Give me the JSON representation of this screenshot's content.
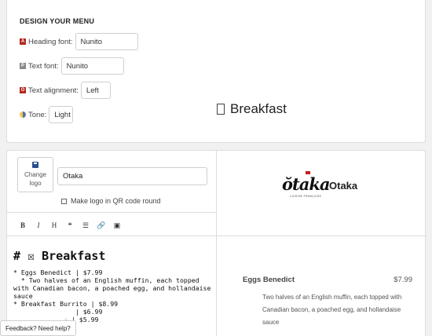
{
  "design": {
    "title": "DESIGN YOUR MENU",
    "options": [
      {
        "icon": "heading-font-icon",
        "icon_glyph": "A",
        "label": "Heading font:",
        "value": "Nunito"
      },
      {
        "icon": "text-font-icon",
        "icon_glyph": "P",
        "label": "Text font:",
        "value": "Nunito"
      },
      {
        "icon": "text-alignment-icon",
        "icon_glyph": "O",
        "label": "Text alignment:",
        "value": "Left"
      },
      {
        "icon": "tone-icon",
        "icon_glyph": "",
        "label": "Tone:",
        "value": "Light"
      }
    ]
  },
  "editor": {
    "change_logo_label_1": "Change",
    "change_logo_label_2": "logo",
    "restaurant_name": "Otaka",
    "round_logo_label": "Make logo in QR code round",
    "toolbar": [
      "B",
      "I",
      "H",
      "❝",
      "☰",
      "🔗",
      "▣"
    ],
    "markdown_lines": [
      "# ☒ Breakfast",
      "",
      "* Eggs Benedict | $7.99",
      "  * Two halves of an English muffin, each topped",
      "with Canadian bacon, a poached egg, and hollandaise",
      "sauce",
      "",
      "* Breakfast Burrito | $8.99",
      "                | $6.99",
      "             ☕ | $5.99"
    ]
  },
  "preview": {
    "logo_text": "ŏtaka",
    "logo_tagline": "CUISINE FRANÇAISE",
    "name": "Otaka",
    "section_title": "Breakfast",
    "item_name": "Eggs Benedict",
    "item_price": "$7.99",
    "item_desc_lines": [
      "Two halves of an English muffin, each topped with",
      "Canadian bacon, a poached egg, and hollandaise",
      "sauce"
    ]
  },
  "feedback_label": "Feedback? Need help?",
  "colors": {
    "accent_red": "#b3261e",
    "save_icon_blue": "#2a4f8f"
  }
}
